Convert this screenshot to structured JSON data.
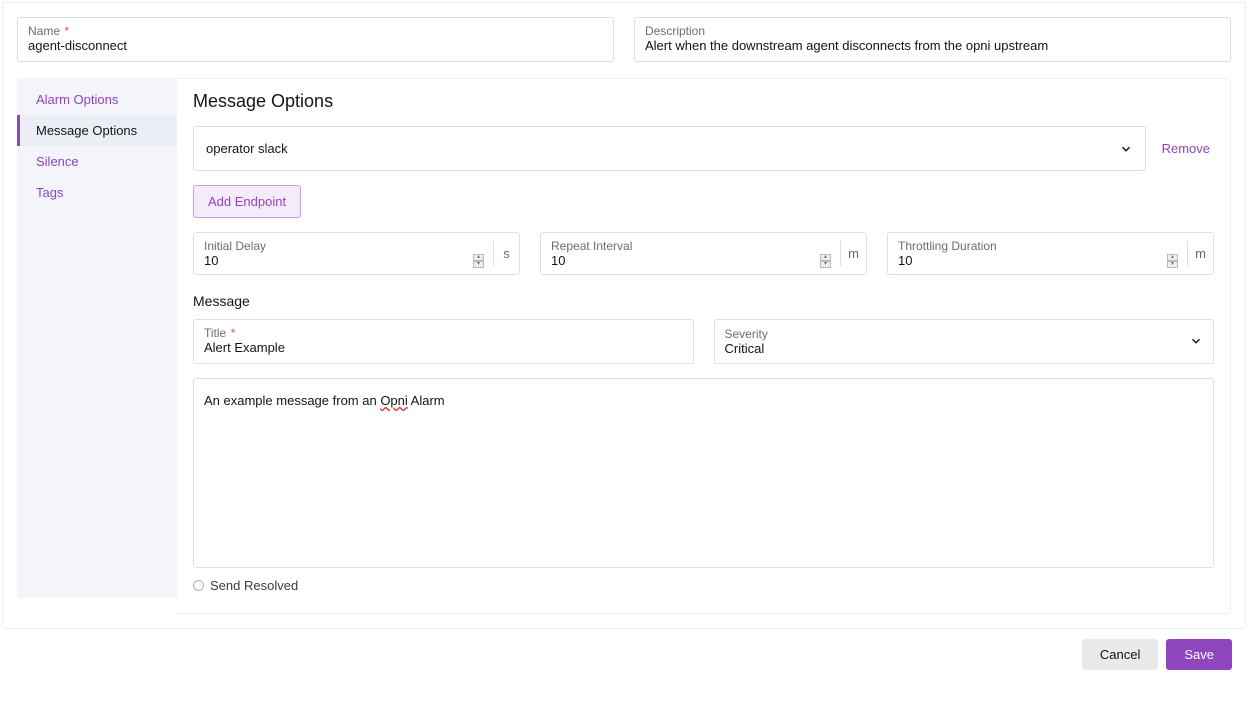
{
  "header": {
    "name_label": "Name",
    "name_value": "agent-disconnect",
    "desc_label": "Description",
    "desc_value": "Alert when the downstream agent disconnects from the opni upstream"
  },
  "sidebar": {
    "items": [
      {
        "label": "Alarm Options",
        "active": false
      },
      {
        "label": "Message Options",
        "active": true
      },
      {
        "label": "Silence",
        "active": false
      },
      {
        "label": "Tags",
        "active": false
      }
    ]
  },
  "section": {
    "title": "Message Options",
    "endpoint_value": "operator slack",
    "remove_label": "Remove",
    "add_endpoint_label": "Add Endpoint"
  },
  "timing": {
    "initial_delay_label": "Initial Delay",
    "initial_delay_value": "10",
    "initial_delay_unit": "s",
    "repeat_interval_label": "Repeat Interval",
    "repeat_interval_value": "10",
    "repeat_interval_unit": "m",
    "throttling_label": "Throttling Duration",
    "throttling_value": "10",
    "throttling_unit": "m"
  },
  "message": {
    "section_label": "Message",
    "title_label": "Title",
    "title_value": "Alert Example",
    "severity_label": "Severity",
    "severity_value": "Critical",
    "body_prefix": "An example message from an ",
    "body_spell": "Opni",
    "body_suffix": " Alarm",
    "send_resolved_label": "Send Resolved"
  },
  "footer": {
    "cancel_label": "Cancel",
    "save_label": "Save"
  }
}
